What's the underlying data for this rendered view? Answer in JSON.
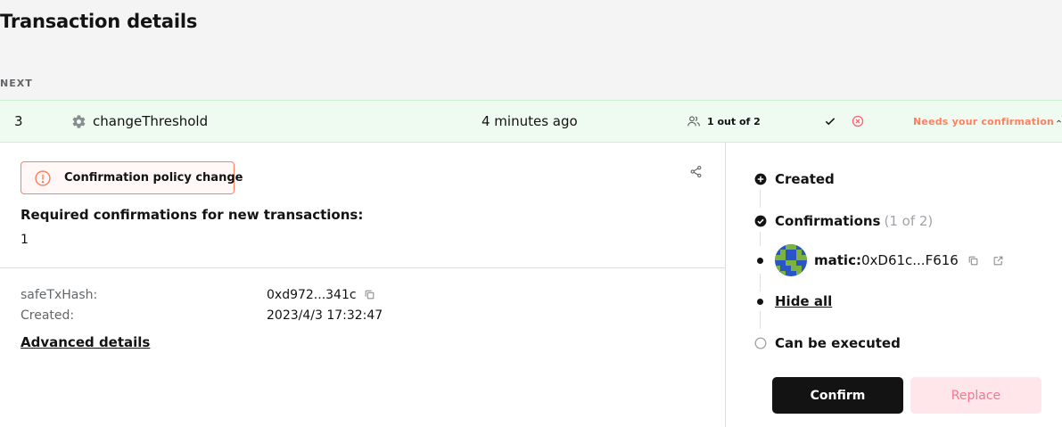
{
  "page": {
    "title": "Transaction details",
    "queue_label": "NEXT"
  },
  "transaction": {
    "nonce": "3",
    "method": "changeThreshold",
    "age": "4 minutes ago",
    "signers": "1 out of 2",
    "status": "Needs your confirmation",
    "status_color": "#ff8061",
    "row_bg": "#effaf1"
  },
  "details": {
    "info_title": "Confirmation policy change",
    "required_label": "Required confirmations for new transactions:",
    "required_value": "1",
    "fields": [
      {
        "key": "safeTxHash:",
        "value": "0xd972...341c"
      },
      {
        "key": "Created:",
        "value": "2023/4/3 17:32:47"
      }
    ],
    "advanced_link": "Advanced details"
  },
  "timeline": {
    "created": "Created",
    "confirmations": "Confirmations",
    "confirmations_count": "(1 of 2)",
    "signer_prefix": "matic:",
    "signer_address": "0xD61c...F616",
    "hide_all": "Hide all",
    "can_execute": "Can be executed"
  },
  "actions": {
    "confirm": "Confirm",
    "replace": "Replace"
  },
  "icons": {
    "method": "gear-icon",
    "signers": "users-icon",
    "approve": "check-icon",
    "reject": "x-circle-icon",
    "info": "info-icon",
    "share": "share-icon",
    "copy": "copy-icon",
    "external": "external-link-icon"
  }
}
